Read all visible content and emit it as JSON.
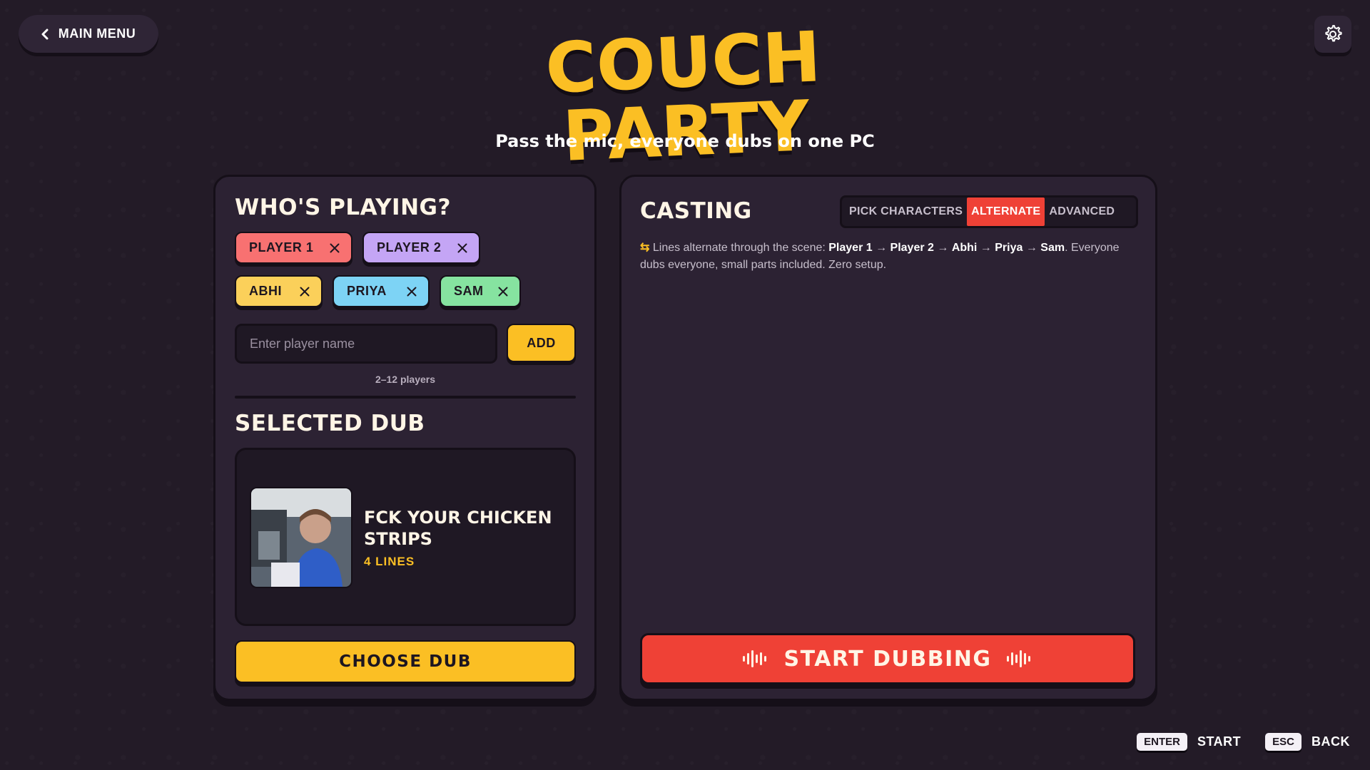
{
  "header": {
    "back_label": "MAIN MENU",
    "title": "COUCH PARTY",
    "subtitle": "Pass the mic, everyone dubs on one PC"
  },
  "players": {
    "heading": "WHO'S PLAYING?",
    "list": [
      {
        "name": "PLAYER 1",
        "color": "#f87171"
      },
      {
        "name": "PLAYER 2",
        "color": "#c4a5f5"
      },
      {
        "name": "ABHI",
        "color": "#fbd05a"
      },
      {
        "name": "PRIYA",
        "color": "#7dd3f5"
      },
      {
        "name": "SAM",
        "color": "#86e3a0"
      }
    ],
    "input_placeholder": "Enter player name",
    "input_value": "",
    "add_label": "ADD",
    "limit_hint": "2–12 players"
  },
  "dub": {
    "heading": "SELECTED DUB",
    "title": "FCK YOUR CHICKEN STRIPS",
    "lines": "4 LINES",
    "choose_label": "CHOOSE DUB"
  },
  "casting": {
    "heading": "CASTING",
    "tabs": [
      {
        "label": "PICK CHARACTERS",
        "active": false
      },
      {
        "label": "ALTERNATE",
        "active": true
      },
      {
        "label": "ADVANCED",
        "active": false
      }
    ],
    "description_intro": "Lines alternate through the scene: ",
    "order": [
      "Player 1",
      "Player 2",
      "Abhi",
      "Priya",
      "Sam"
    ],
    "description_outro": ". Everyone dubs everyone, small parts included. Zero setup.",
    "start_label": "START DUBBING"
  },
  "footer": {
    "hints": [
      {
        "key": "ENTER",
        "label": "START"
      },
      {
        "key": "ESC",
        "label": "BACK"
      }
    ]
  },
  "colors": {
    "accent_yellow": "#fbbf24",
    "accent_red": "#ef4136",
    "panel": "#2c2233",
    "background": "#231b27"
  }
}
